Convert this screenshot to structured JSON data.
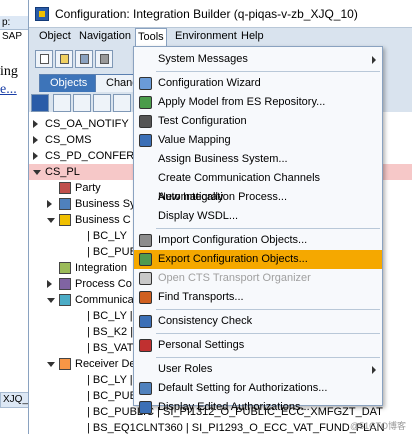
{
  "background_window": {
    "tab_label": "p: SAP",
    "text_line1": "ing",
    "text_link": "e...",
    "bottom_tab": "XJQ_1"
  },
  "window": {
    "title": "Configuration: Integration Builder (q-piqas-v-zb_XJQ_10)"
  },
  "menubar": {
    "items": [
      "Object",
      "Navigation",
      "Tools",
      "Environment",
      "Help"
    ]
  },
  "tabs": {
    "objects": "Objects",
    "changes": "Chang"
  },
  "tree": {
    "rows": [
      {
        "label": "CS_OA_NOTIFY",
        "indent": 0,
        "arrow": "right"
      },
      {
        "label": "CS_OMS",
        "indent": 0,
        "arrow": "right"
      },
      {
        "label": "CS_PD_CONFERE",
        "indent": 0,
        "arrow": "right"
      },
      {
        "label": "CS_PL",
        "indent": 0,
        "arrow": "down",
        "selected": true
      },
      {
        "label": "Party",
        "indent": 1,
        "arrow": "none",
        "icon": "party-icon"
      },
      {
        "label": "Business Sy",
        "indent": 1,
        "arrow": "right",
        "icon": "business-system-icon"
      },
      {
        "label": "Business C",
        "indent": 1,
        "arrow": "down",
        "icon": "business-component-icon"
      },
      {
        "label": "| BC_LY",
        "indent": 3,
        "arrow": "none"
      },
      {
        "label": "| BC_PUBL",
        "indent": 3,
        "arrow": "none"
      },
      {
        "label": "Integration",
        "indent": 1,
        "arrow": "none",
        "icon": "integration-icon"
      },
      {
        "label": "Process Co",
        "indent": 1,
        "arrow": "right",
        "icon": "process-icon"
      },
      {
        "label": "Communica",
        "indent": 1,
        "arrow": "down",
        "icon": "communication-icon"
      },
      {
        "label": "| BC_LY | C",
        "indent": 3,
        "arrow": "none"
      },
      {
        "label": "| BS_K2 | C",
        "indent": 3,
        "arrow": "none"
      },
      {
        "label": "| BS_VAT | C",
        "indent": 3,
        "arrow": "none"
      },
      {
        "label": "Receiver De",
        "indent": 1,
        "arrow": "down",
        "icon": "receiver-icon"
      },
      {
        "label": "| BC_LY | SI",
        "indent": 3,
        "arrow": "none"
      },
      {
        "label": "| BC_PUBL",
        "indent": 3,
        "arrow": "none"
      },
      {
        "label": "| BC_PUBLIC | SI_PI1312_O_PUBLIC_ECC_XMFGZT_DAT",
        "indent": 3,
        "arrow": "none"
      },
      {
        "label": "| BS_EQ1CLNT360 | SI_PI1293_O_ECC_VAT_FUND_PLAN",
        "indent": 3,
        "arrow": "none"
      }
    ]
  },
  "dropdown": {
    "items": [
      {
        "label": "System Messages",
        "icon": "",
        "submenu": true
      },
      {
        "separator": true
      },
      {
        "label": "Configuration Wizard",
        "icon": "wizard-icon"
      },
      {
        "label": "Apply Model from ES Repository...",
        "icon": "model-icon"
      },
      {
        "label": "Test Configuration",
        "icon": "test-icon"
      },
      {
        "label": "Value Mapping",
        "icon": "value-mapping-icon"
      },
      {
        "label": "Assign Business System...",
        "icon": ""
      },
      {
        "label": "Create Communication Channels Automatically",
        "icon": ""
      },
      {
        "label": "New Integration Process...",
        "icon": ""
      },
      {
        "label": "Display WSDL...",
        "icon": ""
      },
      {
        "separator": true
      },
      {
        "label": "Import Configuration Objects...",
        "icon": "import-icon"
      },
      {
        "label": "Export Configuration Objects...",
        "icon": "export-icon",
        "highlight": true
      },
      {
        "label": "Open CTS Transport Organizer",
        "icon": "cts-icon",
        "disabled": true
      },
      {
        "label": "Find Transports...",
        "icon": "transport-icon"
      },
      {
        "separator": true
      },
      {
        "label": "Consistency Check",
        "icon": "consistency-icon"
      },
      {
        "separator": true
      },
      {
        "label": "Personal Settings",
        "icon": "settings-icon"
      },
      {
        "separator": true
      },
      {
        "label": "User Roles",
        "icon": "",
        "submenu": true
      },
      {
        "label": "Default Setting for Authorizations...",
        "icon": "authorization-icon"
      },
      {
        "label": "Display Edited Authorizations...",
        "icon": "display-auth-icon"
      }
    ]
  },
  "watermark": "@51CTO博客"
}
